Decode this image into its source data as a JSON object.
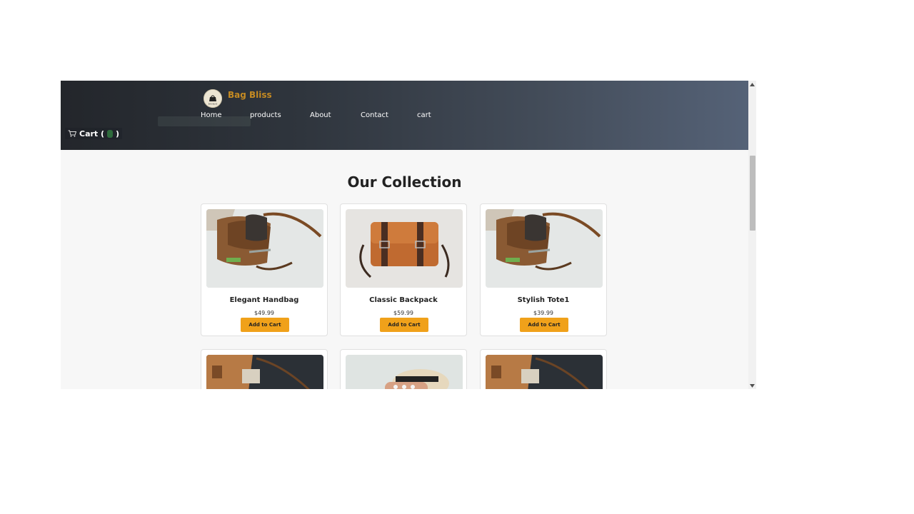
{
  "header": {
    "brand": "Bag Bliss",
    "logo_text": "BAG BLISS",
    "nav": [
      "Home",
      "products",
      "About",
      "Contact",
      "cart"
    ],
    "cart_label": "Cart (",
    "cart_close": ")"
  },
  "main": {
    "title": "Our Collection",
    "products": [
      {
        "name": "Elegant Handbag",
        "price": "$49.99",
        "button": "Add to Cart",
        "image": "brown-bag-open-photo"
      },
      {
        "name": "Classic Backpack",
        "price": "$59.99",
        "button": "Add to Cart",
        "image": "tan-satchel-photo"
      },
      {
        "name": "Stylish Tote1",
        "price": "$39.99",
        "button": "Add to Cart",
        "image": "brown-bag-open-photo"
      },
      {
        "name": "",
        "price": "",
        "button": "",
        "image": "leather-bag-dark-photo"
      },
      {
        "name": "",
        "price": "",
        "button": "",
        "image": "straw-hat-bag-photo"
      },
      {
        "name": "",
        "price": "",
        "button": "",
        "image": "leather-bag-dark-photo"
      }
    ]
  },
  "colors": {
    "accent": "#f0a11a",
    "brand": "#c48a22",
    "header_dark": "#23262b",
    "header_light": "#556277",
    "background": "#f7f7f7"
  }
}
